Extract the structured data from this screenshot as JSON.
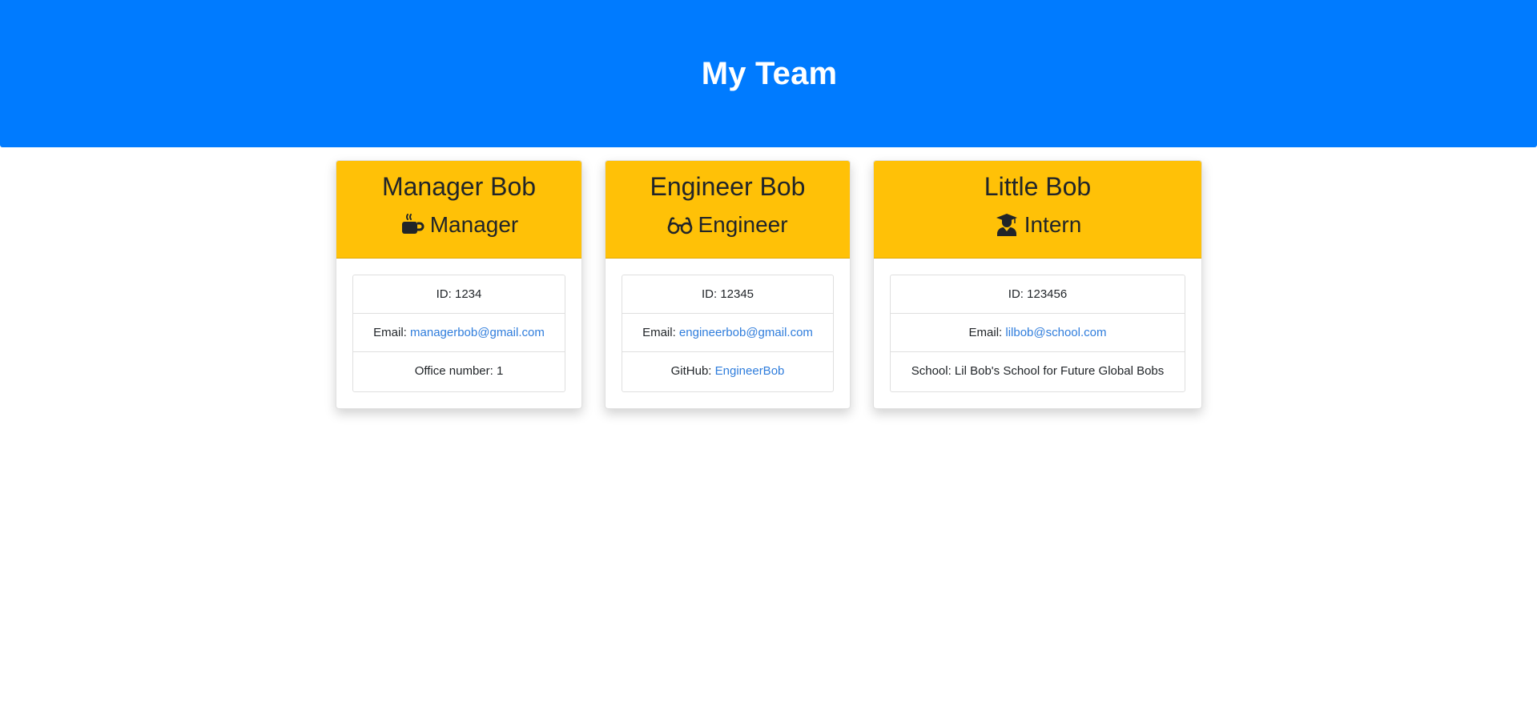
{
  "page": {
    "title": "My Team"
  },
  "colors": {
    "header_bg": "#007bff",
    "card_header_bg": "#ffc107",
    "link": "#2f7ddc"
  },
  "cards": [
    {
      "name": "Manager Bob",
      "role": "Manager",
      "role_icon": "mug-hot-icon",
      "id_label": "ID: ",
      "id_value": "1234",
      "email_label": "Email: ",
      "email_value": "managerbob@gmail.com",
      "extra_label": "Office number: ",
      "extra_value": "1"
    },
    {
      "name": "Engineer Bob",
      "role": "Engineer",
      "role_icon": "glasses-icon",
      "id_label": "ID: ",
      "id_value": "12345",
      "email_label": "Email: ",
      "email_value": "engineerbob@gmail.com",
      "extra_label": "GitHub: ",
      "extra_value": "EngineerBob"
    },
    {
      "name": "Little Bob",
      "role": "Intern",
      "role_icon": "user-graduate-icon",
      "id_label": "ID: ",
      "id_value": "123456",
      "email_label": "Email: ",
      "email_value": "lilbob@school.com",
      "extra_label": "School: ",
      "extra_value": "Lil Bob's School for Future Global Bobs"
    }
  ]
}
